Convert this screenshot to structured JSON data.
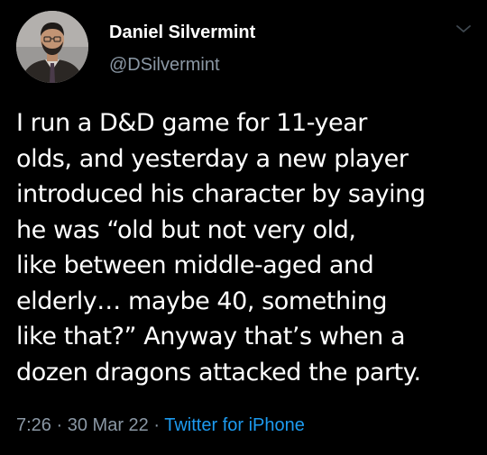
{
  "author": {
    "display_name": "Daniel Silvermint",
    "handle": "@DSilvermint"
  },
  "tweet": {
    "text": "I run a D&D game for 11-year\nolds, and yesterday a new player\nintroduced his character by saying\nhe was “old but not very old,\nlike between middle-aged and\nelderly… maybe 40, something\nlike that?” Anyway that’s when a\ndozen dragons attacked the party.",
    "time": "7:26",
    "separator": "·",
    "date": "30 Mar 22",
    "source": "Twitter for iPhone"
  },
  "icons": {
    "more_menu": "chevron-down-icon",
    "avatar": "profile-photo"
  },
  "colors": {
    "background": "#000000",
    "text_primary": "#ffffff",
    "text_secondary": "#8b98a5",
    "link": "#1d9bf0"
  }
}
